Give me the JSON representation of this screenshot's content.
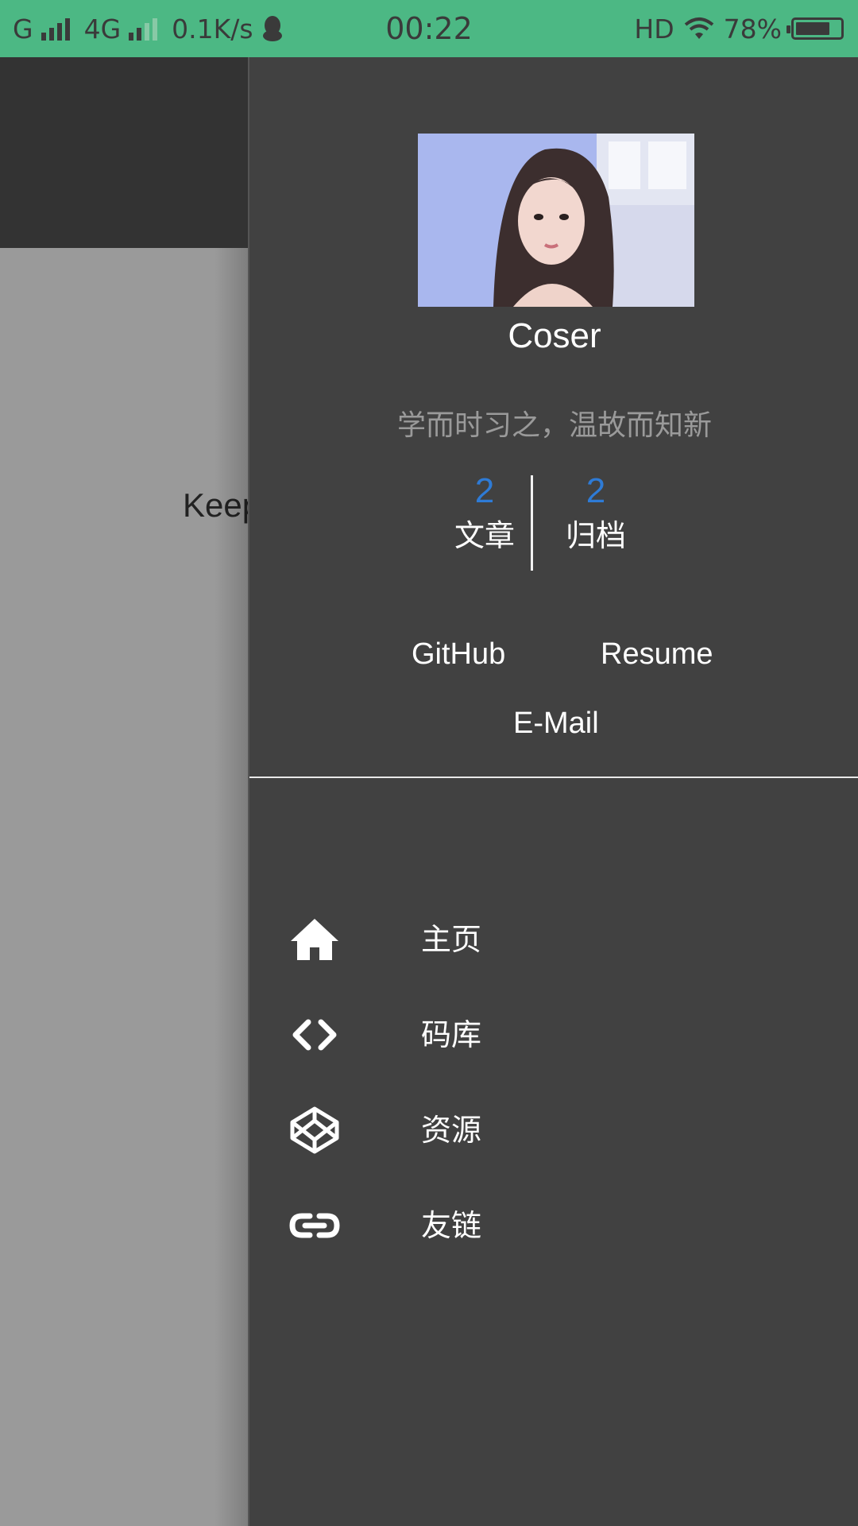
{
  "status_bar": {
    "network_1": "G",
    "network_2": "4G",
    "speed": "0.1K/s",
    "time": "00:22",
    "hd": "HD",
    "battery_percent": "78%",
    "battery_level": 0.78
  },
  "background": {
    "text": "Keep"
  },
  "drawer": {
    "username": "Coser",
    "motto": "学而时习之，温故而知新",
    "stats": [
      {
        "count": "2",
        "label": "文章"
      },
      {
        "count": "2",
        "label": "归档"
      }
    ],
    "links": {
      "github": "GitHub",
      "resume": "Resume",
      "email": "E-Mail"
    },
    "menu": [
      {
        "icon": "home-icon",
        "label": "主页"
      },
      {
        "icon": "code-icon",
        "label": "码库"
      },
      {
        "icon": "codepen-icon",
        "label": "资源"
      },
      {
        "icon": "link-icon",
        "label": "友链"
      }
    ]
  },
  "colors": {
    "status_bar": "#4cb884",
    "drawer_bg": "#414141",
    "accent": "#2e7bd6"
  }
}
